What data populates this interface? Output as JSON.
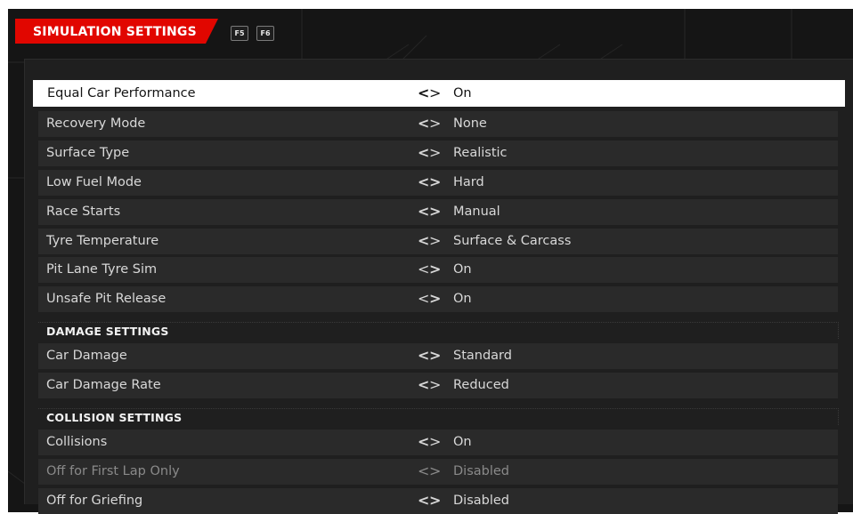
{
  "header": {
    "title": "SIMULATION SETTINGS",
    "key_left": "F5",
    "key_right": "F6"
  },
  "rows": [
    {
      "label": "Equal Car Performance",
      "value": "On",
      "selected": true
    },
    {
      "label": "Recovery Mode",
      "value": "None"
    },
    {
      "label": "Surface Type",
      "value": "Realistic"
    },
    {
      "label": "Low Fuel Mode",
      "value": "Hard"
    },
    {
      "label": "Race Starts",
      "value": "Manual"
    },
    {
      "label": "Tyre Temperature",
      "value": "Surface & Carcass"
    },
    {
      "label": "Pit Lane Tyre Sim",
      "value": "On"
    },
    {
      "label": "Unsafe Pit Release",
      "value": "On"
    }
  ],
  "damage_section": {
    "title": "DAMAGE SETTINGS",
    "rows": [
      {
        "label": "Car Damage",
        "value": "Standard"
      },
      {
        "label": "Car Damage Rate",
        "value": "Reduced"
      }
    ]
  },
  "collision_section": {
    "title": "COLLISION SETTINGS",
    "rows": [
      {
        "label": "Collisions",
        "value": "On"
      },
      {
        "label": "Off for First Lap Only",
        "value": "Disabled",
        "disabled": true
      },
      {
        "label": "Off for Griefing",
        "value": "Disabled"
      }
    ]
  },
  "colors": {
    "accent": "#e10600",
    "background": "#151515",
    "row": "#2a2a2a",
    "selected_row": "#ffffff"
  },
  "icons": {
    "left": "chevron-left-icon",
    "right": "chevron-right-icon"
  }
}
